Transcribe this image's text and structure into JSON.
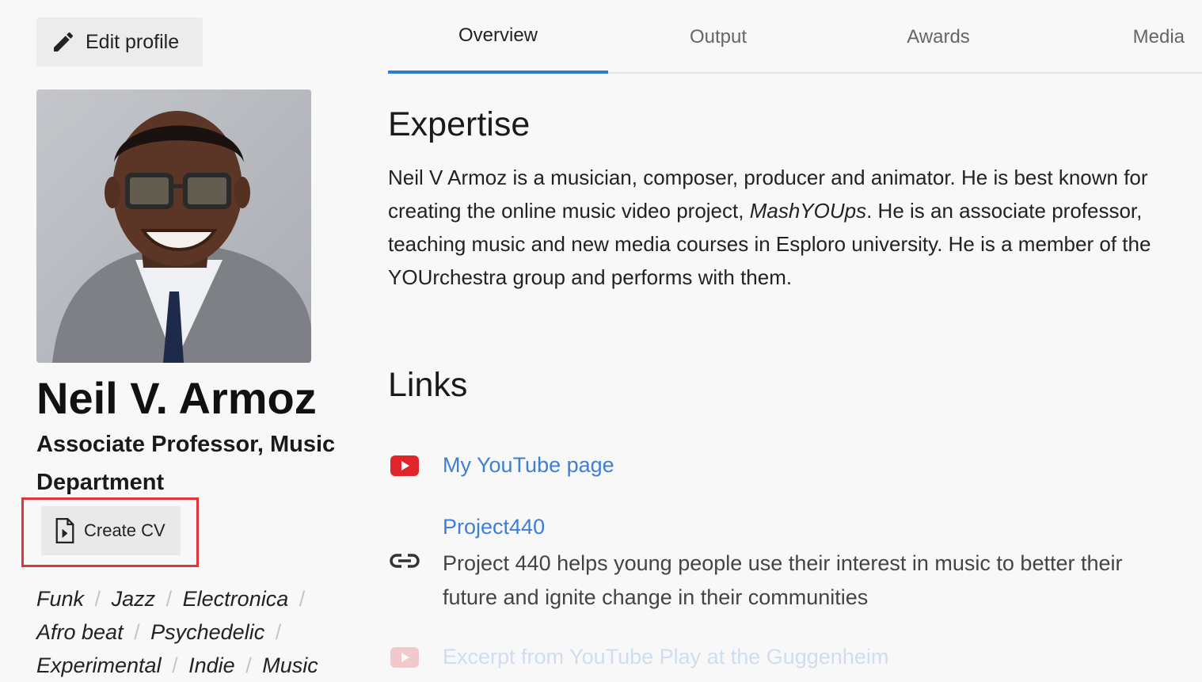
{
  "edit_button": {
    "label": "Edit profile",
    "icon": "pencil-icon"
  },
  "profile": {
    "name": "Neil V. Armoz",
    "title": "Associate Professor, Music Department",
    "create_cv_label": "Create CV",
    "keywords": [
      "Funk",
      "Jazz",
      "Electronica",
      "Afro beat",
      "Psychedelic",
      "Experimental",
      "Indie",
      "Music"
    ]
  },
  "tabs": [
    {
      "label": "Overview",
      "active": true
    },
    {
      "label": "Output",
      "active": false
    },
    {
      "label": "Awards",
      "active": false
    },
    {
      "label": "Media",
      "active": false
    }
  ],
  "overview": {
    "expertise_heading": "Expertise",
    "expertise_before": "Neil V Armoz is a musician, composer, producer and animator. He is best known for creating the online music video project, ",
    "expertise_emphasis": "MashYOUps",
    "expertise_after": ". He is an associate professor, teaching music and new media courses in Esploro university. He is a member of the YOUrchestra group and performs with them.",
    "links_heading": "Links",
    "links": [
      {
        "icon": "youtube-icon",
        "title": "My YouTube page"
      },
      {
        "icon": "chain-link-icon",
        "title": "Project440",
        "description": "Project 440 helps young people use their interest in music to better their future and ignite change in their communities"
      },
      {
        "icon": "youtube-icon",
        "title": "Excerpt from YouTube Play at the Guggenheim"
      }
    ]
  },
  "colors": {
    "accent": "#2f7cd3",
    "link": "#3d7fd6",
    "highlight": "#e0333c",
    "youtube": "#e0262a"
  }
}
